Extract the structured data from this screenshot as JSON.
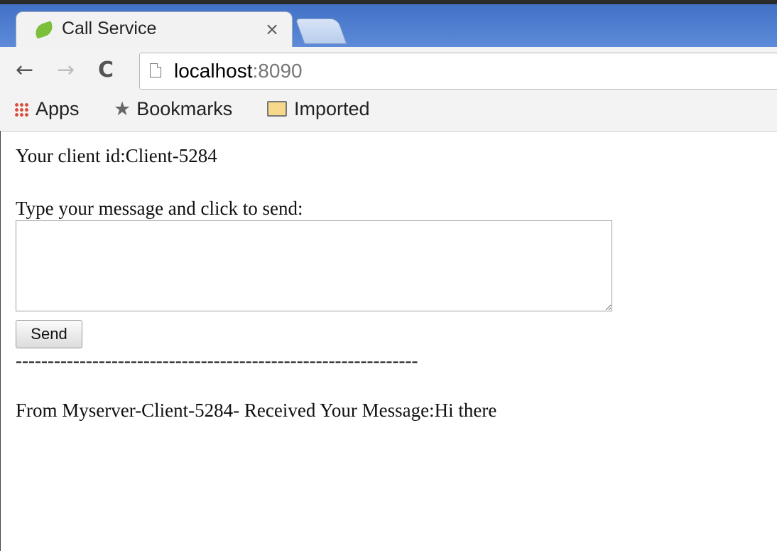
{
  "browser": {
    "tab_title": "Call Service",
    "tab_close": "×",
    "nav_back": "←",
    "nav_forward": "→",
    "nav_reload": "C",
    "url_host": "localhost",
    "url_port": ":8090",
    "bookmarks": {
      "apps": "Apps",
      "star": "★",
      "bookmarks": "Bookmarks",
      "imported": "Imported"
    }
  },
  "page": {
    "client_line": "Your client id:Client-5284",
    "prompt": "Type your message and click to send:",
    "message_value": "",
    "send_label": "Send",
    "separator": "---------------------------------------------------------------",
    "response": "From Myserver-Client-5284- Received Your Message:Hi there"
  },
  "icons": {
    "favicon": "leaf-icon",
    "page": "page-icon",
    "apps": "apps-grid-icon",
    "bookmarks": "star-icon",
    "imported": "folder-icon"
  },
  "colors": {
    "tabstrip": "#4f7fcf",
    "favicon": "#7bbf3a"
  }
}
